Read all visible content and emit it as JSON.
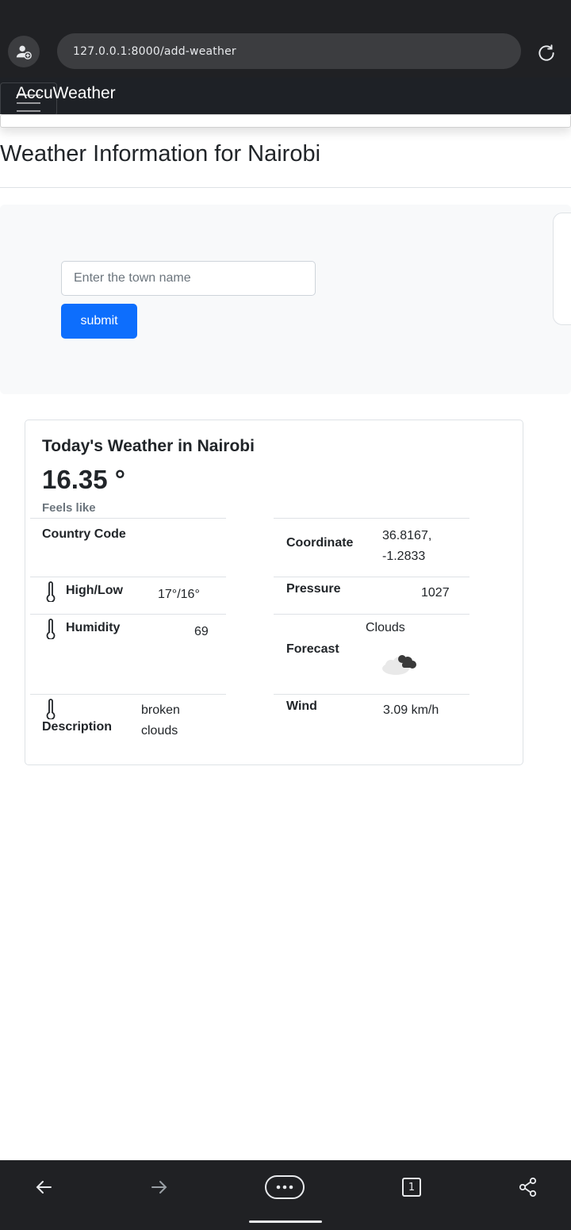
{
  "browser": {
    "url": "127.0.0.1:8000/add-weather"
  },
  "navbar": {
    "brand": "AccuWeather"
  },
  "page": {
    "title": "Weather Information for Nairobi"
  },
  "search": {
    "placeholder": "Enter the town name",
    "value": "",
    "submit_label": "submit"
  },
  "weather": {
    "title": "Today's Weather in Nairobi",
    "temperature": "16.35 °",
    "feels_like_label": "Feels like",
    "country_code_label": "Country Code",
    "country_code_value": "",
    "coordinate_label": "Coordinate",
    "coordinate_line1": "36.8167,",
    "coordinate_line2": "-1.2833",
    "high_low_label": "High/Low",
    "high_low_value": "17°/16°",
    "pressure_label": "Pressure",
    "pressure_value": "1027",
    "humidity_label": "Humidity",
    "humidity_value": "69",
    "forecast_label": "Forecast",
    "forecast_value": "Clouds",
    "forecast_icon": "broken-clouds-icon",
    "description_label": "Description",
    "description_line1": "broken",
    "description_line2": "clouds",
    "wind_label": "Wind",
    "wind_value": "3.09 km/h"
  },
  "bottom_bar": {
    "tab_count": "1"
  },
  "colors": {
    "primary": "#0d6efd",
    "navbar_bg": "#1e2126",
    "chrome_bg": "#202124"
  }
}
